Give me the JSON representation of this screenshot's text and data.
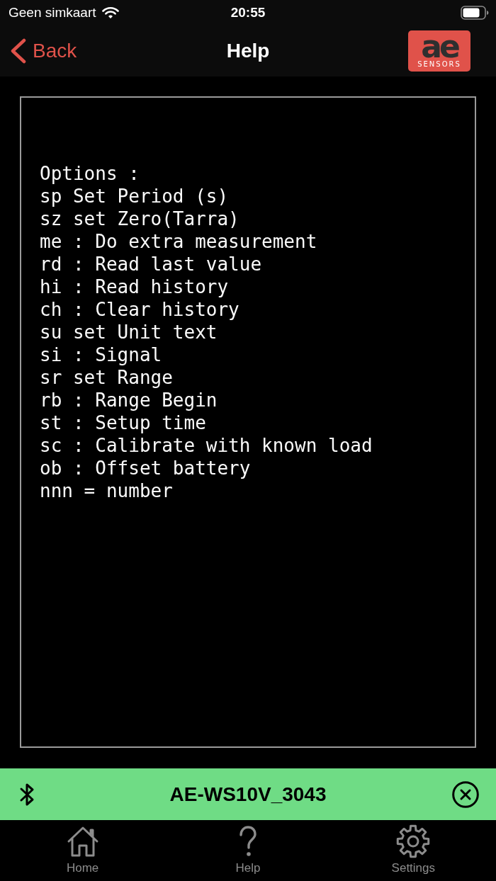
{
  "status_bar": {
    "carrier": "Geen simkaart",
    "time": "20:55"
  },
  "nav_bar": {
    "back": "Back",
    "title": "Help",
    "logo": {
      "mark": "ae",
      "caption": "SENSORS"
    }
  },
  "terminal": {
    "lines": [
      "Options :",
      "sp Set Period (s)",
      "sz set Zero(Tarra)",
      "me : Do extra measurement",
      "rd : Read last value",
      "hi : Read history",
      "ch : Clear history",
      "su set Unit text",
      "si : Signal",
      "sr set Range",
      "rb : Range Begin",
      "st : Setup time",
      "sc : Calibrate with known load",
      "ob : Offset battery",
      "nnn = number"
    ]
  },
  "device_bar": {
    "name": "AE-WS10V_3043"
  },
  "tab_bar": {
    "tabs": [
      {
        "kind": "home",
        "label": "Home"
      },
      {
        "kind": "help",
        "label": "Help"
      },
      {
        "kind": "settings",
        "label": "Settings"
      }
    ]
  }
}
